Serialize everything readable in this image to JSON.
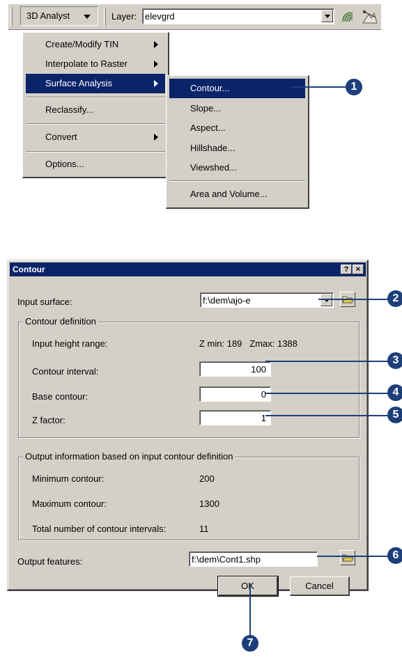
{
  "toolbar": {
    "menu_label": "3D Analyst",
    "layer_label": "Layer:",
    "layer_value": "elevgrd"
  },
  "analyst_menu": {
    "items": [
      {
        "label": "Create/Modify TIN",
        "submenu": true
      },
      {
        "label": "Interpolate to Raster",
        "submenu": true
      },
      {
        "label": "Surface Analysis",
        "submenu": true,
        "selected": true
      },
      {
        "label": "Reclassify...",
        "submenu": false
      },
      {
        "label": "Convert",
        "submenu": true
      },
      {
        "label": "Options...",
        "submenu": false
      }
    ]
  },
  "surface_submenu": {
    "items": [
      "Contour...",
      "Slope...",
      "Aspect...",
      "Hillshade...",
      "Viewshed...",
      "Area and Volume..."
    ]
  },
  "dialog": {
    "title": "Contour",
    "help_button": "?",
    "close_button": "×",
    "input_surface_label": "Input surface:",
    "input_surface_value": "f:\\dem\\ajo-e",
    "contour_definition_title": "Contour definition",
    "height_range_label": "Input height range:",
    "height_range_value": "Z min: 189   Zmax: 1388",
    "interval_label": "Contour interval:",
    "interval_value": "100",
    "base_label": "Base contour:",
    "base_value": "0",
    "zfactor_label": "Z factor:",
    "zfactor_value": "1",
    "output_info_title": "Output information based on input contour definition",
    "min_label": "Minimum contour:",
    "min_value": "200",
    "max_label": "Maximum contour:",
    "max_value": "1300",
    "total_label": "Total number of contour intervals:",
    "total_value": "11",
    "output_label": "Output features:",
    "output_value": "f:\\dem\\Cont1.shp",
    "ok_label": "OK",
    "cancel_label": "Cancel"
  },
  "callouts": [
    "1",
    "2",
    "3",
    "4",
    "5",
    "6",
    "7"
  ],
  "colors": {
    "selection": "#0a246a",
    "callout": "#1d3f7a",
    "face": "#d4d0c8"
  }
}
